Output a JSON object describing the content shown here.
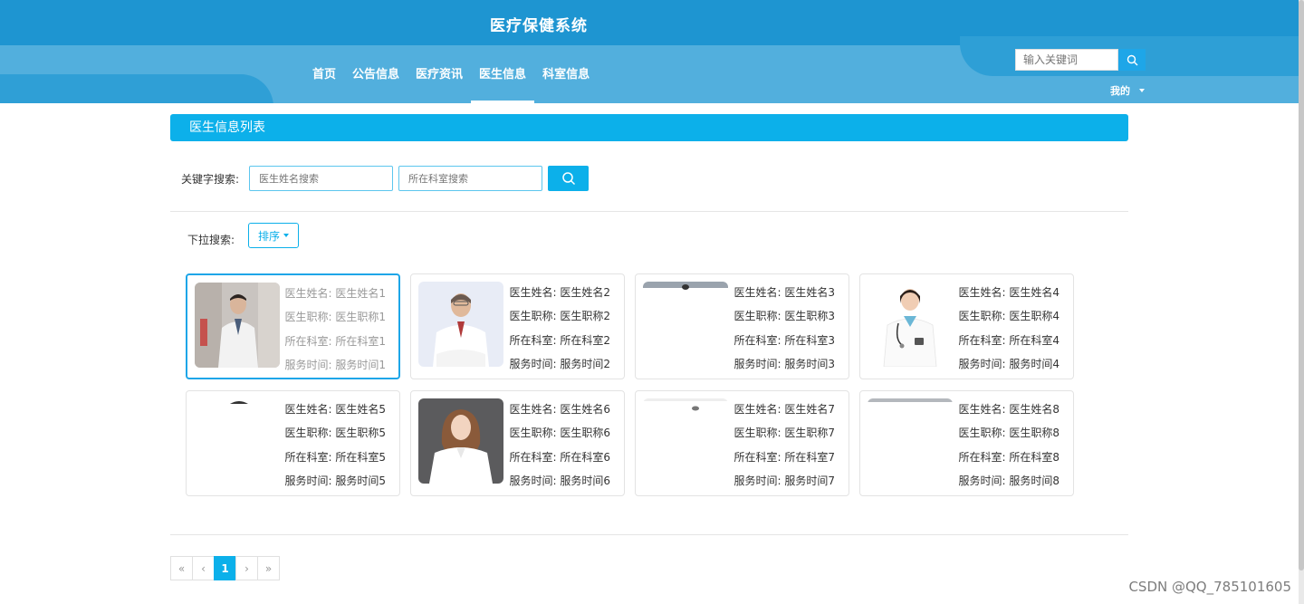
{
  "header": {
    "site_title": "医疗保健系统",
    "nav": [
      {
        "label": "首页",
        "active": false
      },
      {
        "label": "公告信息",
        "active": false
      },
      {
        "label": "医疗资讯",
        "active": false
      },
      {
        "label": "医生信息",
        "active": true
      },
      {
        "label": "科室信息",
        "active": false
      }
    ],
    "search_placeholder": "输入关键词",
    "my_menu_label": "我的"
  },
  "main": {
    "list_title": "医生信息列表",
    "keyword_search_label": "关键字搜索:",
    "doctor_name_placeholder": "医生姓名搜索",
    "department_placeholder": "所在科室搜索",
    "dropdown_search_label": "下拉搜索:",
    "sort_button_label": "排序"
  },
  "field_labels": {
    "name": "医生姓名:",
    "title": "医生职称:",
    "department": "所在科室:",
    "service_time": "服务时间:"
  },
  "doctors": [
    {
      "name": "医生姓名1",
      "title": "医生职称1",
      "department": "所在科室1",
      "service_time": "服务时间1",
      "photo": "male-doctor-hallway-photo",
      "selected": true
    },
    {
      "name": "医生姓名2",
      "title": "医生职称2",
      "department": "所在科室2",
      "service_time": "服务时间2",
      "photo": "senior-male-doctor-photo",
      "selected": false
    },
    {
      "name": "医生姓名3",
      "title": "医生职称3",
      "department": "所在科室3",
      "service_time": "服务时间3",
      "photo": "blank-photo",
      "selected": false
    },
    {
      "name": "医生姓名4",
      "title": "医生职称4",
      "department": "所在科室4",
      "service_time": "服务时间4",
      "photo": "female-doctor-photo",
      "selected": false
    },
    {
      "name": "医生姓名5",
      "title": "医生职称5",
      "department": "所在科室5",
      "service_time": "服务时间5",
      "photo": "blank-photo",
      "selected": false
    },
    {
      "name": "医生姓名6",
      "title": "医生职称6",
      "department": "所在科室6",
      "service_time": "服务时间6",
      "photo": "female-doctor-dark-bg-photo",
      "selected": false
    },
    {
      "name": "医生姓名7",
      "title": "医生职称7",
      "department": "所在科室7",
      "service_time": "服务时间7",
      "photo": "blank-photo",
      "selected": false
    },
    {
      "name": "医生姓名8",
      "title": "医生职称8",
      "department": "所在科室8",
      "service_time": "服务时间8",
      "photo": "blank-photo",
      "selected": false
    }
  ],
  "pagination": {
    "first": "«",
    "prev": "‹",
    "current": "1",
    "next": "›",
    "last": "»"
  },
  "watermark": "CSDN @QQ_785101605",
  "colors": {
    "header_dark": "#1e95d1",
    "header_light": "#52afdd",
    "accent": "#0cb0ea",
    "selected_border": "#1ea6e8"
  }
}
